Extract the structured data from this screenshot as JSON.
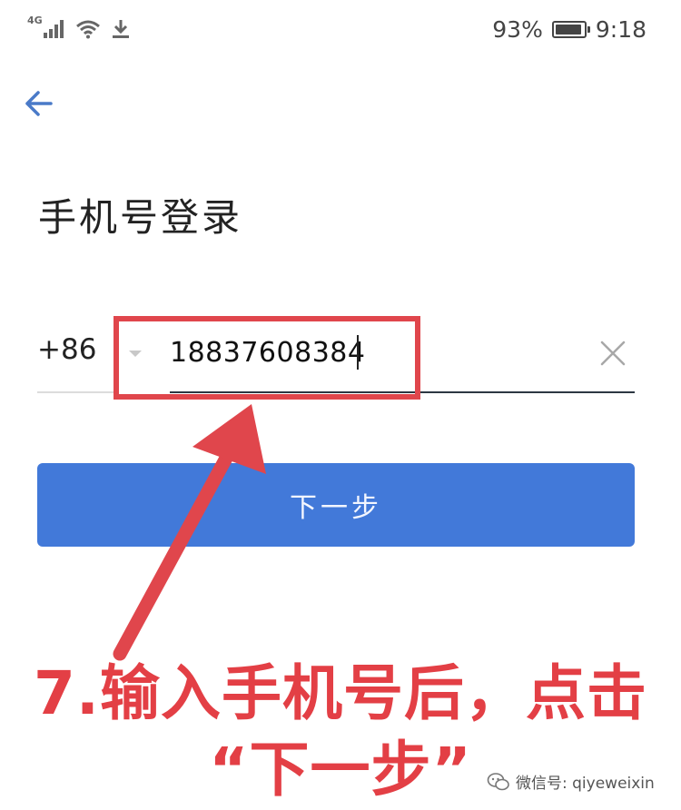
{
  "status_bar": {
    "network": "4G",
    "battery": "93%",
    "battery_level": 0.93,
    "time": "9:18"
  },
  "header": {
    "back_icon": "arrow-left-icon"
  },
  "page": {
    "title": "手机号登录"
  },
  "phone_form": {
    "country_code": "+86",
    "dropdown_icon": "triangle-down-icon",
    "phone_value": "18837608384",
    "clear_icon": "close-icon",
    "next_label": "下一步"
  },
  "annotation": {
    "line1": "7.输入手机号后，点击",
    "line2": "“下一步”",
    "highlight_color": "#e0464c"
  },
  "watermark": {
    "text": "微信号: qiyeweixin"
  },
  "colors": {
    "primary": "#4279d9",
    "annotation_red": "#e33f45"
  }
}
